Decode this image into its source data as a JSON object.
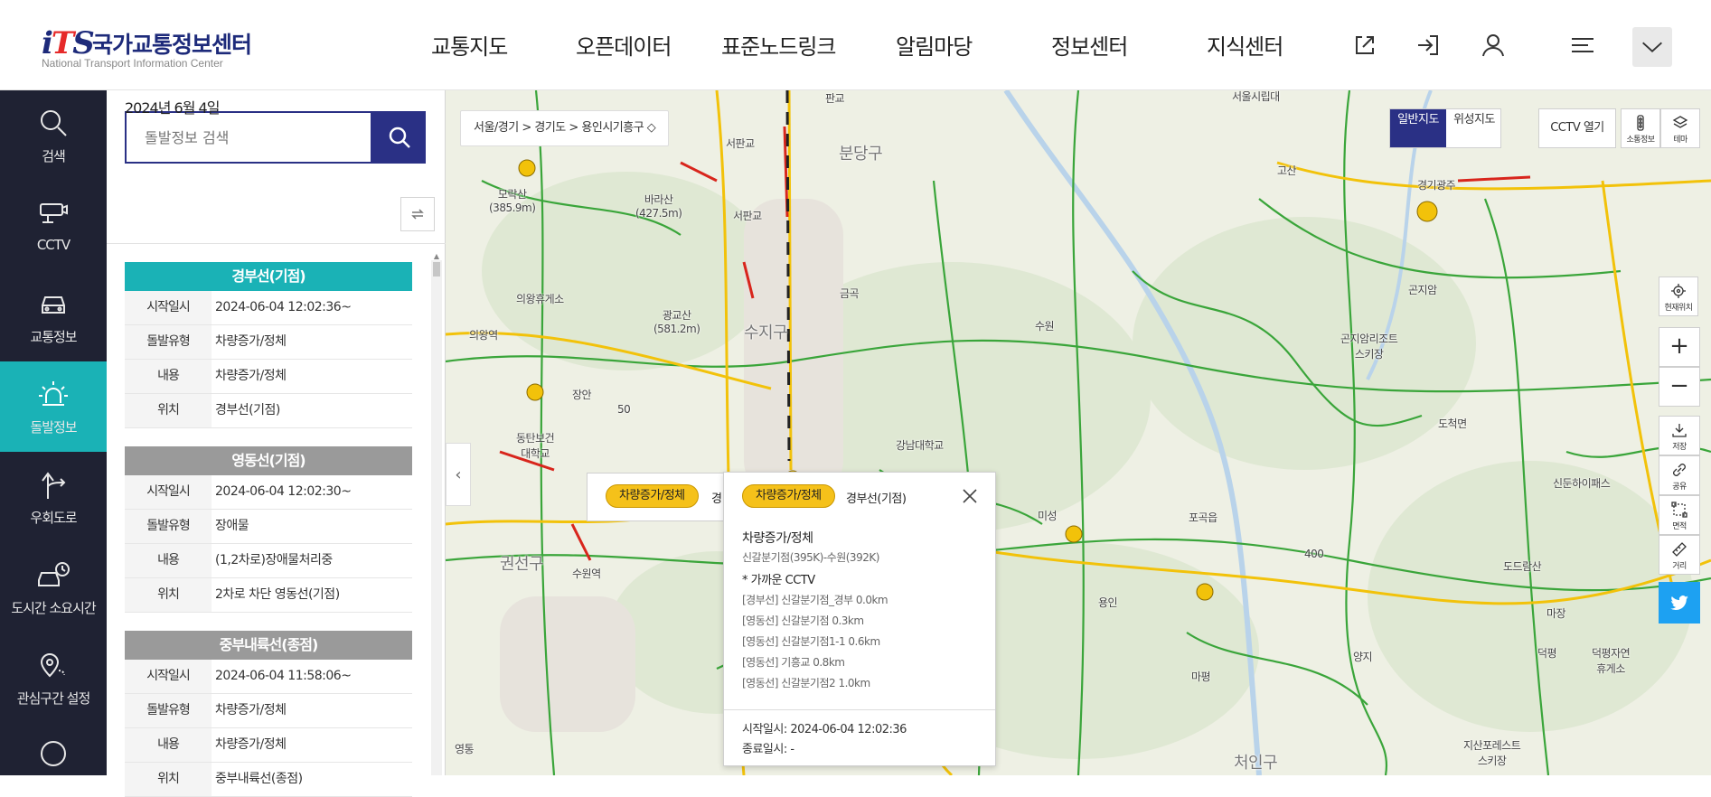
{
  "header": {
    "logo_mark": "iTS",
    "logo_title": "국가교통정보센터",
    "logo_sub": "National Transport Information Center",
    "nav": [
      "교통지도",
      "오픈데이터",
      "표준노드링크",
      "알림마당",
      "정보센터",
      "지식센터"
    ],
    "icons": [
      "external-link-icon",
      "login-icon",
      "user-icon",
      "menu-icon",
      "chevron-down-icon"
    ]
  },
  "sidenav": {
    "items": [
      {
        "label": "검색",
        "icon": "search-icon"
      },
      {
        "label": "CCTV",
        "icon": "cctv-icon"
      },
      {
        "label": "교통정보",
        "icon": "car-icon"
      },
      {
        "label": "돌발정보",
        "icon": "alert-light-icon",
        "active": true
      },
      {
        "label": "우회도로",
        "icon": "detour-icon"
      },
      {
        "label": "도시간 소요시간",
        "icon": "car-clock-icon"
      },
      {
        "label": "관심구간 설정",
        "icon": "pin-icon"
      }
    ]
  },
  "panel": {
    "search_placeholder": "돌발정보 검색",
    "date": "2024년 6월 4일",
    "incidents": [
      {
        "title": "경부선(기점)",
        "head_color": "#1ab2b6",
        "rows": [
          {
            "k": "시작일시",
            "v": "2024-06-04  12:02:36~"
          },
          {
            "k": "돌발유형",
            "v": "차량증가/정체"
          },
          {
            "k": "내용",
            "v": "차량증가/정체"
          },
          {
            "k": "위치",
            "v": "경부선(기점)"
          }
        ]
      },
      {
        "title": "영동선(기점)",
        "head_color": "#9a9a9a",
        "rows": [
          {
            "k": "시작일시",
            "v": "2024-06-04  12:02:30~"
          },
          {
            "k": "돌발유형",
            "v": "장애물"
          },
          {
            "k": "내용",
            "v": "(1,2차로)장애물처리중"
          },
          {
            "k": "위치",
            "v": "2차로 차단 영동선(기점)"
          }
        ]
      },
      {
        "title": "중부내륙선(종점)",
        "head_color": "#9a9a9a",
        "rows": [
          {
            "k": "시작일시",
            "v": "2024-06-04  11:58:06~"
          },
          {
            "k": "돌발유형",
            "v": "차량증가/정체"
          },
          {
            "k": "내용",
            "v": "차량증가/정체"
          },
          {
            "k": "위치",
            "v": "중부내륙선(종점)"
          }
        ]
      }
    ]
  },
  "map": {
    "breadcrumb": "서울/경기  >  경기도  >  용인시기흥구 ◇",
    "map_type": {
      "on": "일반지도",
      "off": "위성지도"
    },
    "cctv_button": "CCTV 열기",
    "tools_top": [
      {
        "label": "소통정보",
        "icon": "traffic-light-icon"
      },
      {
        "label": "테마",
        "icon": "layers-icon"
      }
    ],
    "location_label": "현재위치",
    "zoom_in": "+",
    "zoom_out": "−",
    "tools_side": [
      {
        "label": "저장",
        "icon": "download-icon"
      },
      {
        "label": "공유",
        "icon": "share-icon"
      },
      {
        "label": "면적",
        "icon": "area-icon"
      },
      {
        "label": "거리",
        "icon": "ruler-icon"
      }
    ],
    "labels": [
      "서울시립대",
      "판교",
      "분당구",
      "고산",
      "서판교",
      "경기광주",
      "모락산\n(385.9m)",
      "바라산\n(427.5m)",
      "서판교",
      "의왕휴게소",
      "광교산\n(581.2m)",
      "금곡",
      "곤지암",
      "수지구",
      "의왕역",
      "수원",
      "곤지암리조트\n스키장",
      "장안",
      "도척면",
      "50",
      "동탄보건\n대학교",
      "강남대학교",
      "수원역",
      "권선구",
      "미성",
      "포곡읍",
      "용인",
      "마평",
      "양지",
      "400",
      "도드람산",
      "신둔하이패스",
      "마장",
      "덕평",
      "덕평자연\n휴게소",
      "지산포레스트\n스키장",
      "처인구",
      "영통"
    ],
    "popup_back": {
      "pill": "차량증가/정체",
      "road": "경"
    },
    "popup": {
      "pill": "차량증가/정체",
      "road": "경부선(기점)",
      "line1": "차량증가/정체",
      "line2": "신갈분기점(395K)-수원(392K)",
      "line3": "* 가까운 CCTV",
      "cctv": [
        "[경부선] 신갈분기점_경부  0.0km",
        "[영동선] 신갈분기점  0.3km",
        "[영동선] 신갈분기점1-1  0.6km",
        "[영동선] 기흥교  0.8km",
        "[영동선] 신갈분기점2  1.0km"
      ],
      "start": "시작일시:  2024-06-04  12:02:36",
      "end": "종료일시:  -"
    }
  }
}
